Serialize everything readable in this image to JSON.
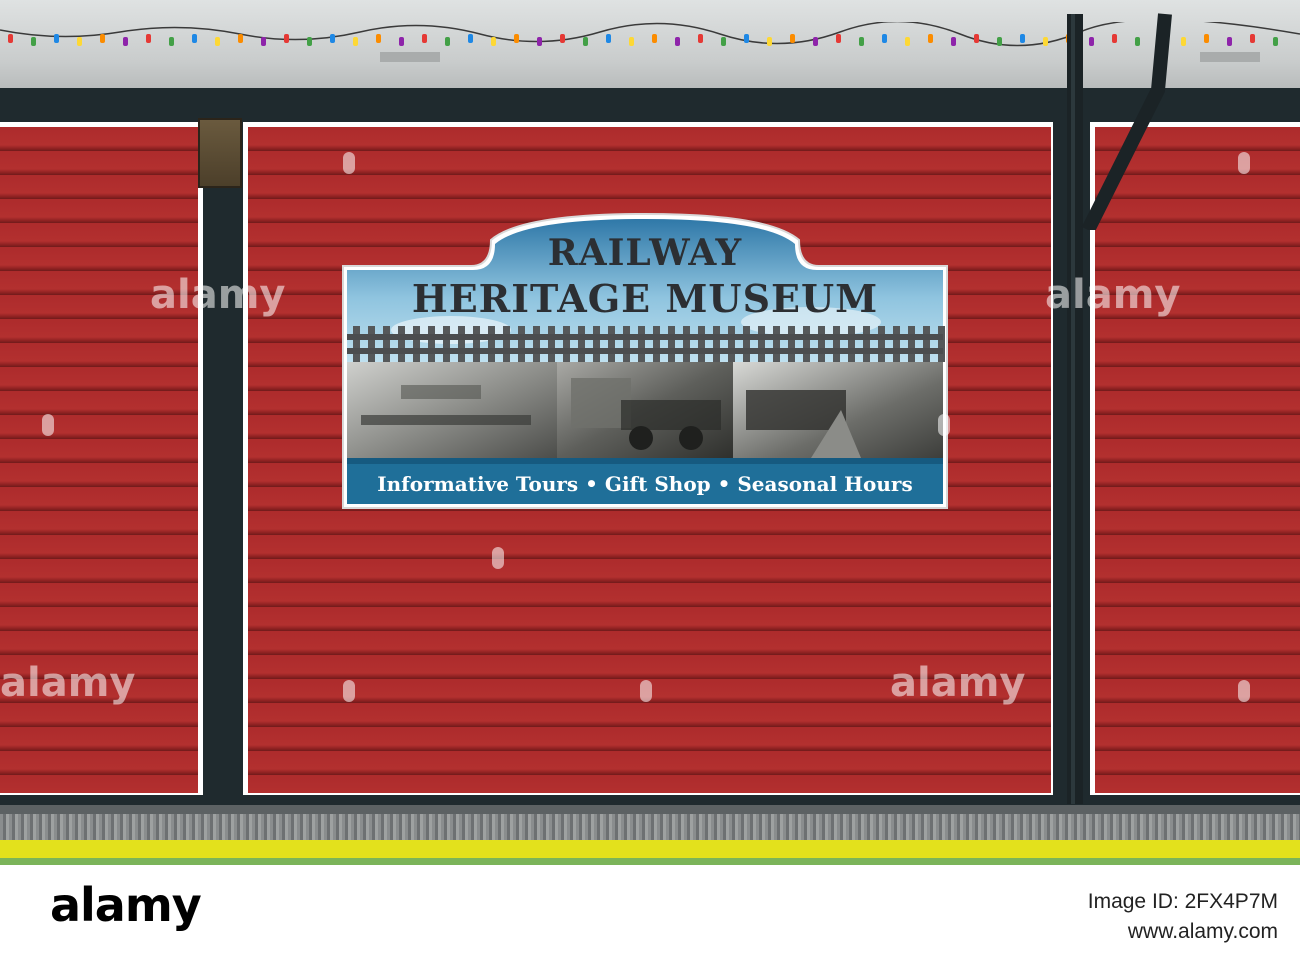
{
  "sign": {
    "title_line1": "RAILWAY",
    "title_line2": "HERITAGE MUSEUM",
    "caption": "Informative Tours • Gift Shop • Seasonal Hours"
  },
  "watermark": {
    "text": "alamy"
  },
  "footer": {
    "logo": "alamy",
    "image_id_label": "Image ID: 2FX4P7M",
    "site": "www.alamy.com"
  },
  "colors": {
    "siding_red": "#ad2b2c",
    "trim_dark": "#1f2a2e",
    "sign_blue": "#1f6f99",
    "curb_yellow": "#e3e11c"
  }
}
